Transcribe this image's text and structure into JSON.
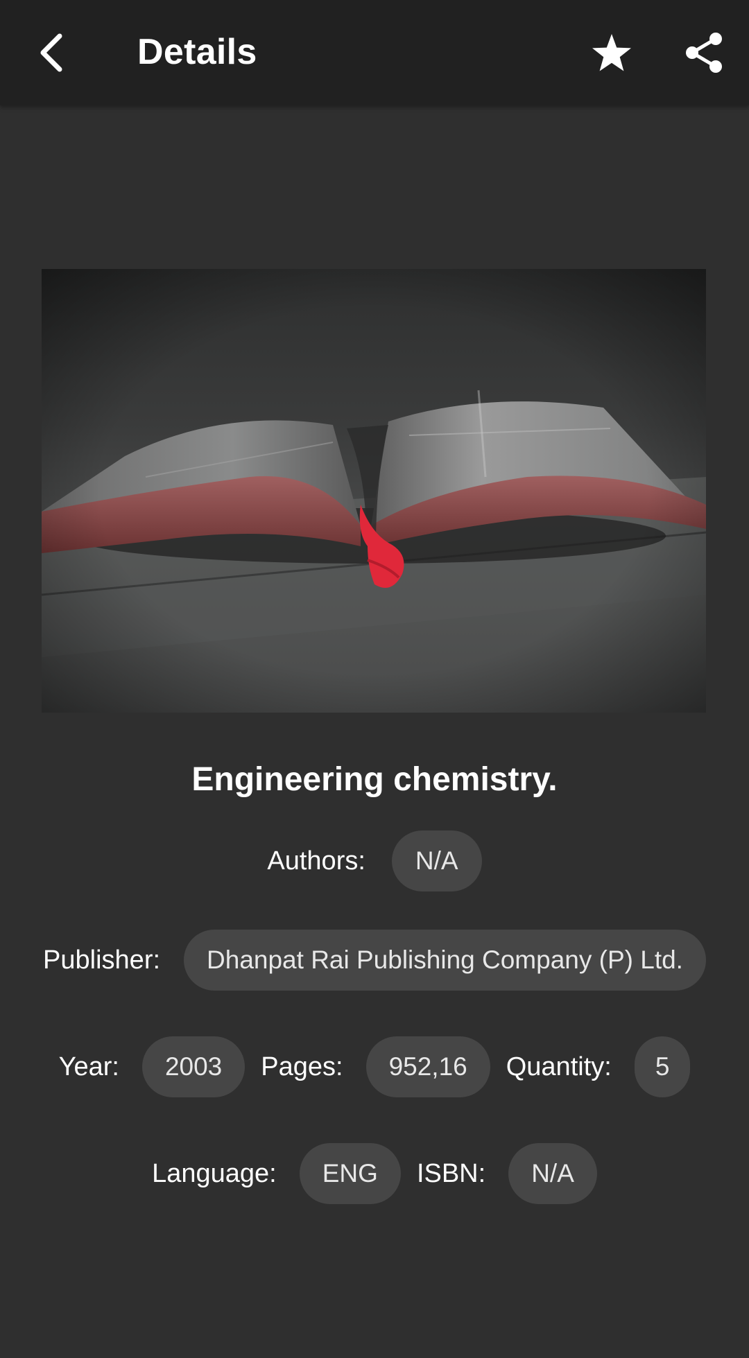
{
  "appbar": {
    "title": "Details",
    "back_icon": "chevron-left-icon",
    "favorite_icon": "star-icon",
    "share_icon": "share-icon"
  },
  "cover": {
    "image_description_icon": "open-book-photo"
  },
  "book": {
    "title": "Engineering chemistry.",
    "authors_label": "Authors:",
    "authors_value": "N/A",
    "publisher_label": "Publisher:",
    "publisher_value": "Dhanpat Rai Publishing Company (P) Ltd.",
    "year_label": "Year:",
    "year_value": "2003",
    "pages_label": "Pages:",
    "pages_value": "952,16",
    "quantity_label": "Quantity:",
    "quantity_value": "5",
    "language_label": "Language:",
    "language_value": "ENG",
    "isbn_label": "ISBN:",
    "isbn_value": "N/A"
  },
  "colors": {
    "background": "#2f2f2f",
    "appbar": "#212121",
    "chip": "#464646",
    "text": "#ffffff",
    "bookmark_accent": "#e0283a"
  }
}
